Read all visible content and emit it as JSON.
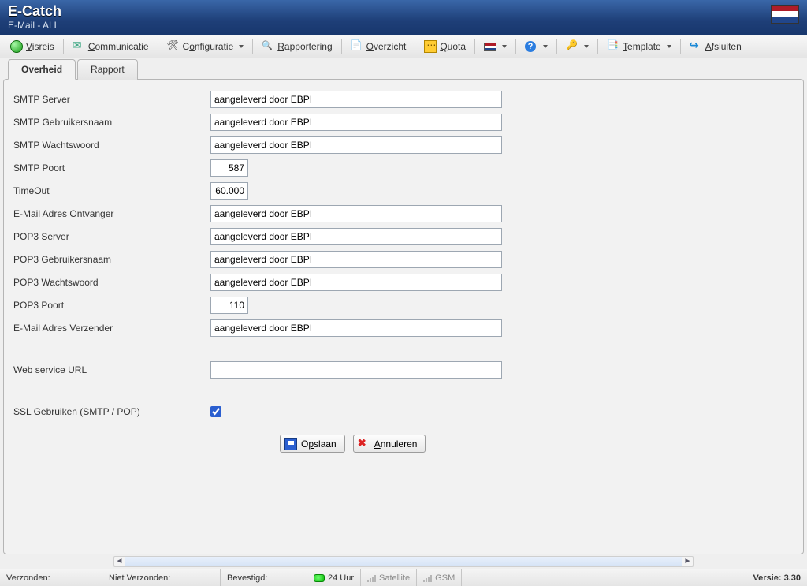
{
  "header": {
    "title": "E-Catch",
    "subtitle": "E-Mail - ALL"
  },
  "toolbar": {
    "visreis": "Visreis",
    "communicatie": "Communicatie",
    "configuratie": "Configuratie",
    "rapportering": "Rapportering",
    "overzicht": "Overzicht",
    "quota": "Quota",
    "template": "Template",
    "afsluiten": "Afsluiten"
  },
  "tabs": {
    "overheid": "Overheid",
    "rapport": "Rapport"
  },
  "form": {
    "smtp_server": {
      "label": "SMTP Server",
      "value": "aangeleverd door EBPI"
    },
    "smtp_user": {
      "label": "SMTP Gebruikersnaam",
      "value": "aangeleverd door EBPI"
    },
    "smtp_pass": {
      "label": "SMTP Wachtswoord",
      "value": "aangeleverd door EBPI"
    },
    "smtp_port": {
      "label": "SMTP Poort",
      "value": "587"
    },
    "timeout": {
      "label": "TimeOut",
      "value": "60.000"
    },
    "email_recv": {
      "label": "E-Mail Adres Ontvanger",
      "value": "aangeleverd door EBPI"
    },
    "pop3_server": {
      "label": "POP3 Server",
      "value": "aangeleverd door EBPI"
    },
    "pop3_user": {
      "label": "POP3 Gebruikersnaam",
      "value": "aangeleverd door EBPI"
    },
    "pop3_pass": {
      "label": "POP3 Wachtswoord",
      "value": "aangeleverd door EBPI"
    },
    "pop3_port": {
      "label": "POP3 Poort",
      "value": "110"
    },
    "email_send": {
      "label": "E-Mail Adres Verzender",
      "value": "aangeleverd door EBPI"
    },
    "web_url": {
      "label": "Web service URL",
      "value": ""
    },
    "ssl": {
      "label": "SSL Gebruiken (SMTP / POP)",
      "checked": true
    }
  },
  "buttons": {
    "save": "Opslaan",
    "cancel": "Annuleren"
  },
  "status": {
    "verzonden": "Verzonden:",
    "niet_verzonden": "Niet Verzonden:",
    "bevestigd": "Bevestigd:",
    "uur24": "24 Uur",
    "satellite": "Satellite",
    "gsm": "GSM",
    "versie": "Versie: 3.30"
  }
}
